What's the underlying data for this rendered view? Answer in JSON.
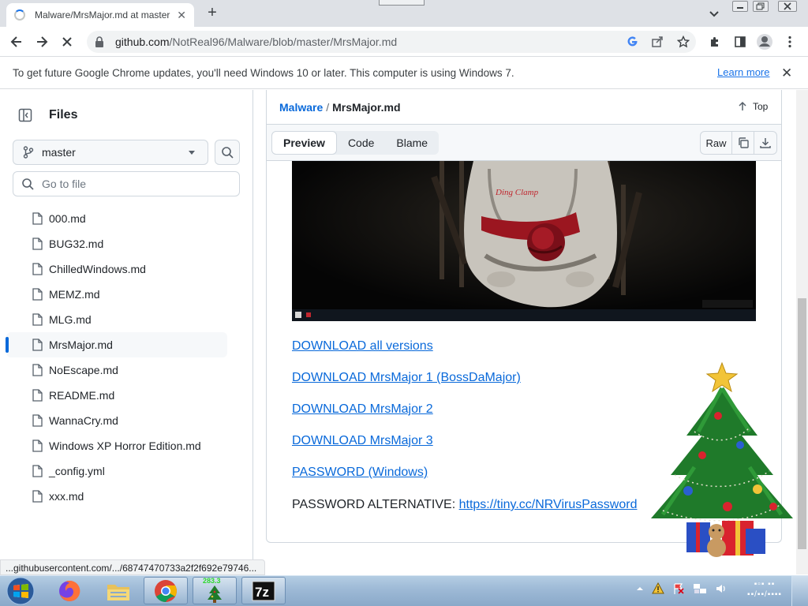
{
  "browser": {
    "tab_title": "Malware/MrsMajor.md at master",
    "url_domain": "github.com",
    "url_path": "/NotReal96/Malware/blob/master/MrsMajor.md",
    "infobar_text": "To get future Google Chrome updates, you'll need Windows 10 or later. This computer is using Windows 7.",
    "infobar_link": "Learn more",
    "status_url": "...githubusercontent.com/.../68747470733a2f2f692e79746..."
  },
  "sidebar": {
    "title": "Files",
    "branch": "master",
    "goto_placeholder": "Go to file",
    "files": [
      {
        "name": "000.md"
      },
      {
        "name": "BUG32.md"
      },
      {
        "name": "ChilledWindows.md"
      },
      {
        "name": "MEMZ.md"
      },
      {
        "name": "MLG.md"
      },
      {
        "name": "MrsMajor.md",
        "active": true
      },
      {
        "name": "NoEscape.md"
      },
      {
        "name": "README.md"
      },
      {
        "name": "WannaCry.md"
      },
      {
        "name": "Windows XP Horror Edition.md"
      },
      {
        "name": "_config.yml"
      },
      {
        "name": "xxx.md"
      }
    ]
  },
  "main": {
    "breadcrumb_repo": "Malware",
    "breadcrumb_sep": "/",
    "breadcrumb_file": "MrsMajor.md",
    "top_label": "Top",
    "views": [
      "Preview",
      "Code",
      "Blame"
    ],
    "raw_label": "Raw",
    "hero_overlay_text": "Ding Clamp",
    "links": [
      "DOWNLOAD all versions",
      "DOWNLOAD MrsMajor 1 (BossDaMajor)",
      "DOWNLOAD MrsMajor 2",
      "DOWNLOAD MrsMajor 3",
      "PASSWORD (Windows)"
    ],
    "password_alt_label": "PASSWORD ALTERNATIVE:",
    "password_alt_url": "https://tiny.cc/NRVirusPassword"
  },
  "taskbar": {
    "gadget_label": "283.3"
  },
  "colors": {
    "link": "#0969da",
    "accent": "#1a73e8",
    "active_file_bar": "#0969da",
    "taskbar": "#9db9d6"
  }
}
